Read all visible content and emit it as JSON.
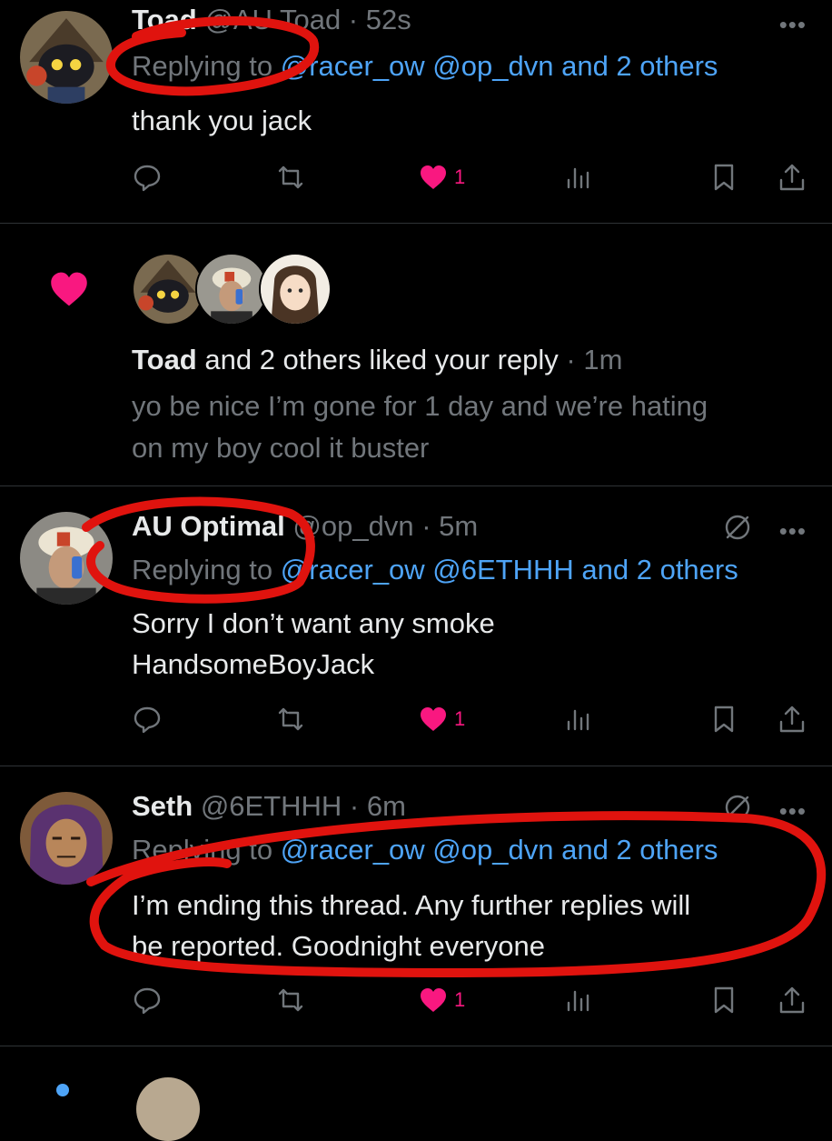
{
  "tweets": [
    {
      "name": "Toad",
      "handle": "@AU Toad",
      "time": "52s",
      "replying_prefix": "Replying to ",
      "replying_to": "@racer_ow @op_dvn and 2 others",
      "text": "thank you jack",
      "likes": "1"
    },
    {
      "name": "AU Optimal",
      "handle": "@op_dvn",
      "time": "5m",
      "replying_prefix": "Replying to ",
      "replying_to": "@racer_ow @6ETHHH and 2 others",
      "text_line1": "Sorry I don’t want any smoke",
      "text_line2": "HandsomeBoyJack",
      "likes": "1"
    },
    {
      "name": "Seth",
      "handle": "@6ETHHH",
      "time": "6m",
      "replying_prefix": "Replying to ",
      "replying_to": "@racer_ow @op_dvn and 2 others",
      "text_line1": "I’m ending this thread. Any further replies will",
      "text_line2": "be reported. Goodnight everyone",
      "likes": "1"
    }
  ],
  "notification": {
    "bold_name": "Toad",
    "rest": " and 2 others liked your reply",
    "time": "1m",
    "quoted_line1": "yo be nice I’m gone for 1 day and we’re hating",
    "quoted_line2": "on my boy cool it buster"
  },
  "separator": " · ",
  "more_glyph": "•••",
  "colors": {
    "background": "#000000",
    "link": "#4ea4f7",
    "muted": "#71767b",
    "like": "#f91880",
    "annotation": "#e0130e"
  },
  "icons": [
    "reply-icon",
    "retweet-icon",
    "heart-icon",
    "views-icon",
    "bookmark-icon",
    "share-icon",
    "more-icon",
    "do-not-disturb-icon"
  ]
}
